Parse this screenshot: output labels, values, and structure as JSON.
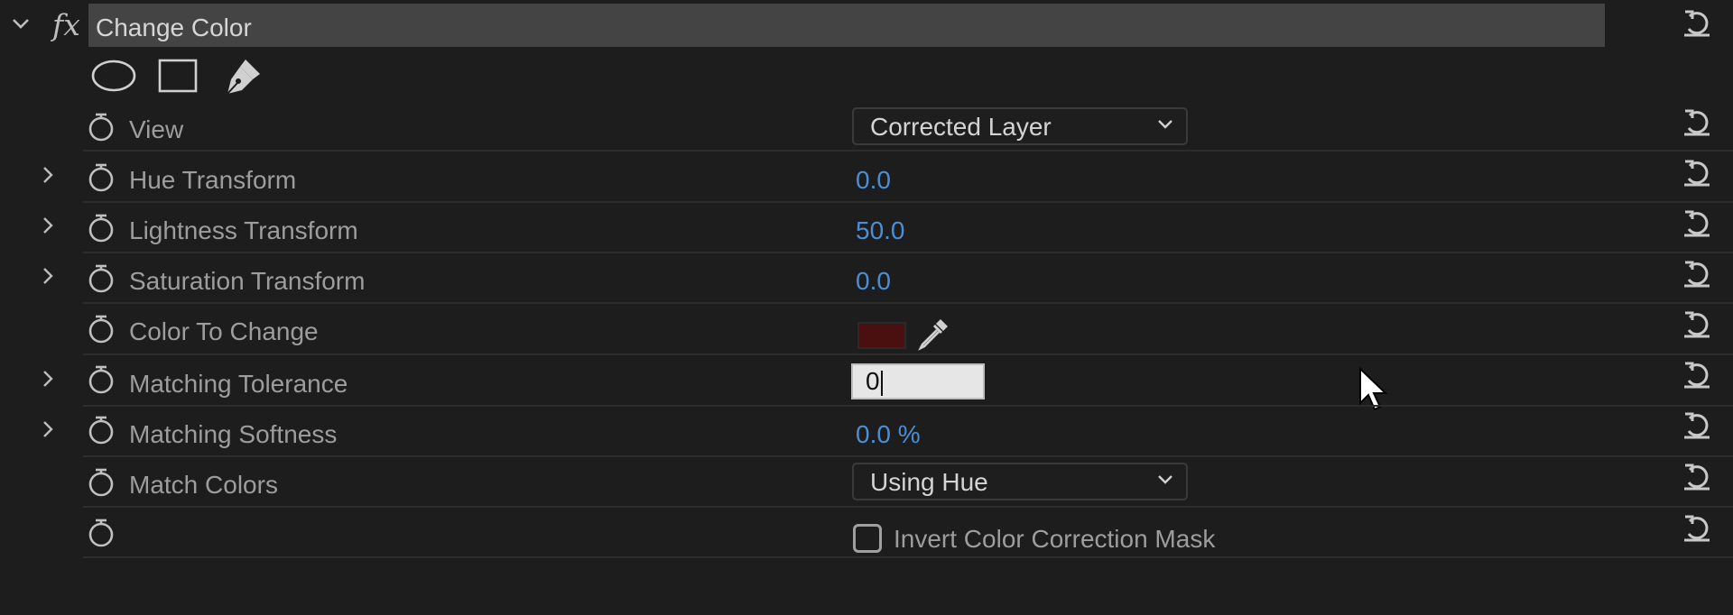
{
  "effect": {
    "fx_symbol": "fx",
    "title": "Change Color"
  },
  "mask_tools": [
    "ellipse-mask-icon",
    "rectangle-mask-icon",
    "pen-mask-icon"
  ],
  "rows": {
    "view": {
      "label": "View",
      "value": "Corrected Layer"
    },
    "hue_transform": {
      "label": "Hue Transform",
      "value": "0.0"
    },
    "lightness_transform": {
      "label": "Lightness Transform",
      "value": "50.0"
    },
    "saturation_transform": {
      "label": "Saturation Transform",
      "value": "0.0"
    },
    "color_to_change": {
      "label": "Color To Change",
      "swatch_color": "#4a1010"
    },
    "matching_tolerance": {
      "label": "Matching Tolerance",
      "value": "0"
    },
    "matching_softness": {
      "label": "Matching Softness",
      "value": "0.0 %"
    },
    "match_colors": {
      "label": "Match Colors",
      "value": "Using Hue"
    },
    "invert_mask": {
      "label": "Invert Color Correction Mask",
      "checked": false
    }
  },
  "colors": {
    "background": "#1d1d1d",
    "header_bar": "#444444",
    "label": "#9d9d9d",
    "value_blue": "#4a8fd6"
  }
}
